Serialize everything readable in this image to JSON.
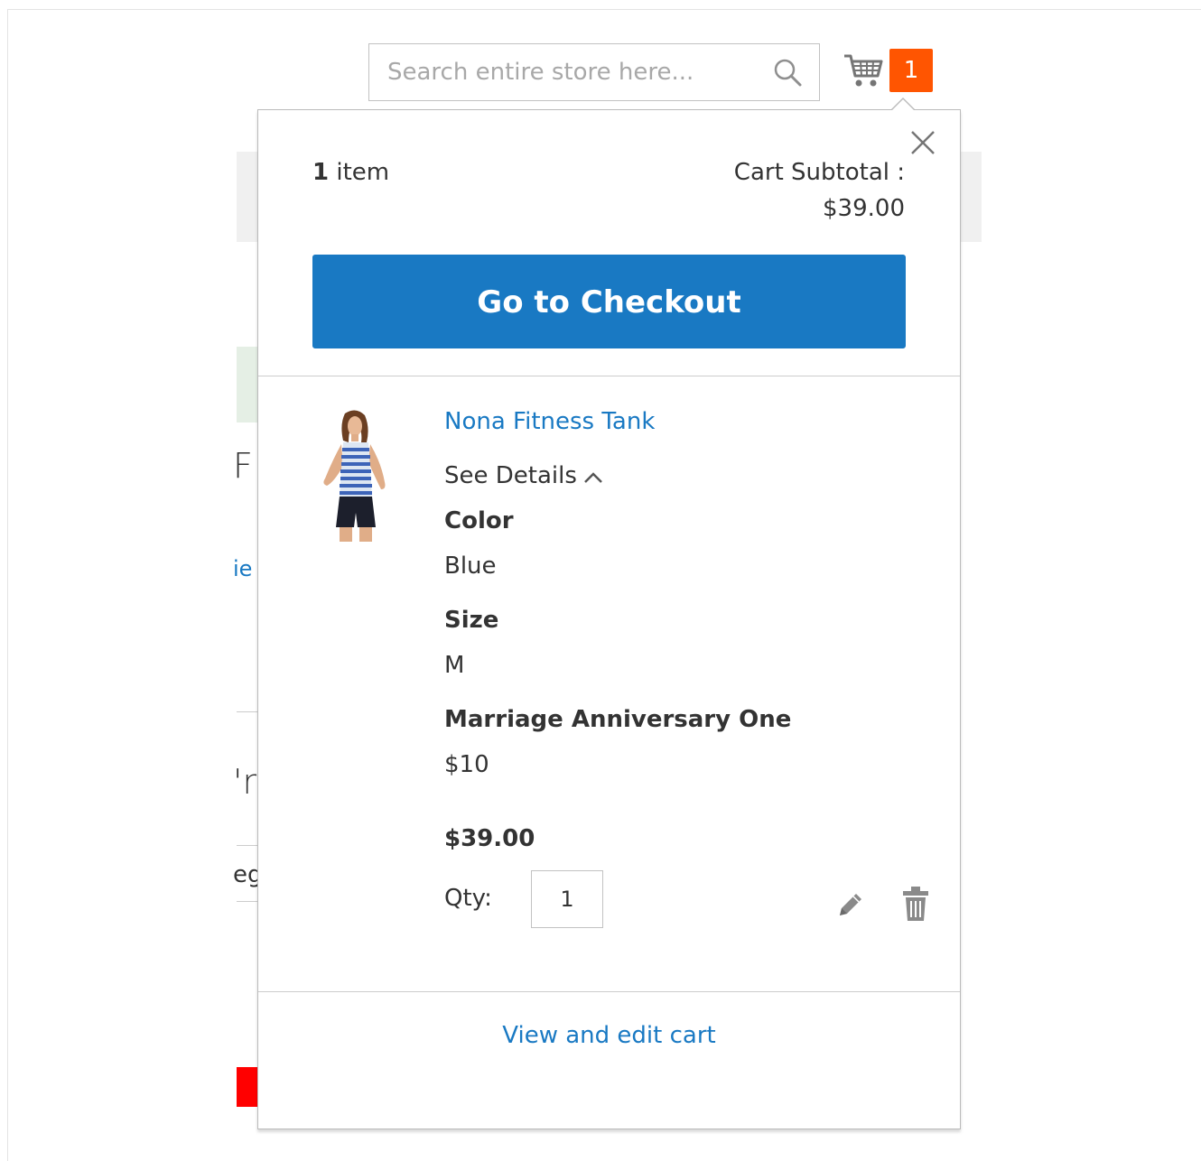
{
  "search": {
    "placeholder": "Search entire store here..."
  },
  "minicart": {
    "counter": "1",
    "items_count": "1",
    "items_word": "item",
    "subtotal_label": "Cart Subtotal :",
    "subtotal_price": "$39.00",
    "checkout_label": "Go to Checkout",
    "view_cart_label": "View and edit cart"
  },
  "product": {
    "name": "Nona Fitness Tank",
    "see_details": "See Details",
    "options": [
      {
        "label": "Color",
        "value": "Blue"
      },
      {
        "label": "Size",
        "value": "M"
      },
      {
        "label": "Marriage Anniversary One",
        "value": "$10"
      }
    ],
    "price": "$39.00",
    "qty_label": "Qty:",
    "qty_value": "1"
  },
  "background": {
    "fragment_1": "F",
    "fragment_2": "ie",
    "fragment_3": "'r",
    "fragment_4": "eg"
  },
  "colors": {
    "accent": "#1979c3",
    "counter": "#ff5501",
    "text": "#333333",
    "border": "#cccccc"
  },
  "icons": [
    "search-icon",
    "cart-icon",
    "close-icon",
    "chevron-up-icon",
    "edit-icon",
    "trash-icon"
  ]
}
